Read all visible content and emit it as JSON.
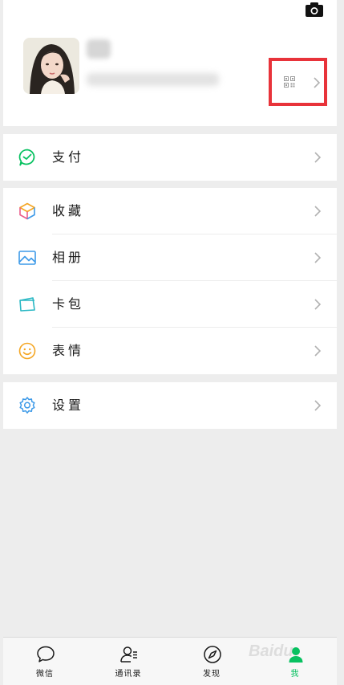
{
  "menu": [
    {
      "label": "支付",
      "icon": "pay-icon"
    },
    {
      "label": "收藏",
      "icon": "favorites-icon"
    },
    {
      "label": "相册",
      "icon": "album-icon"
    },
    {
      "label": "卡包",
      "icon": "card-wallet-icon"
    },
    {
      "label": "表情",
      "icon": "sticker-icon"
    },
    {
      "label": "设置",
      "icon": "settings-icon"
    }
  ],
  "tabs": [
    {
      "label": "微信",
      "icon": "chat-icon"
    },
    {
      "label": "通讯录",
      "icon": "contacts-icon"
    },
    {
      "label": "发现",
      "icon": "discover-icon"
    },
    {
      "label": "我",
      "icon": "me-icon",
      "active": true
    }
  ],
  "watermark": "Baidu",
  "colors": {
    "accent": "#07c160",
    "highlight": "#e8333a",
    "background": "#ededed"
  }
}
